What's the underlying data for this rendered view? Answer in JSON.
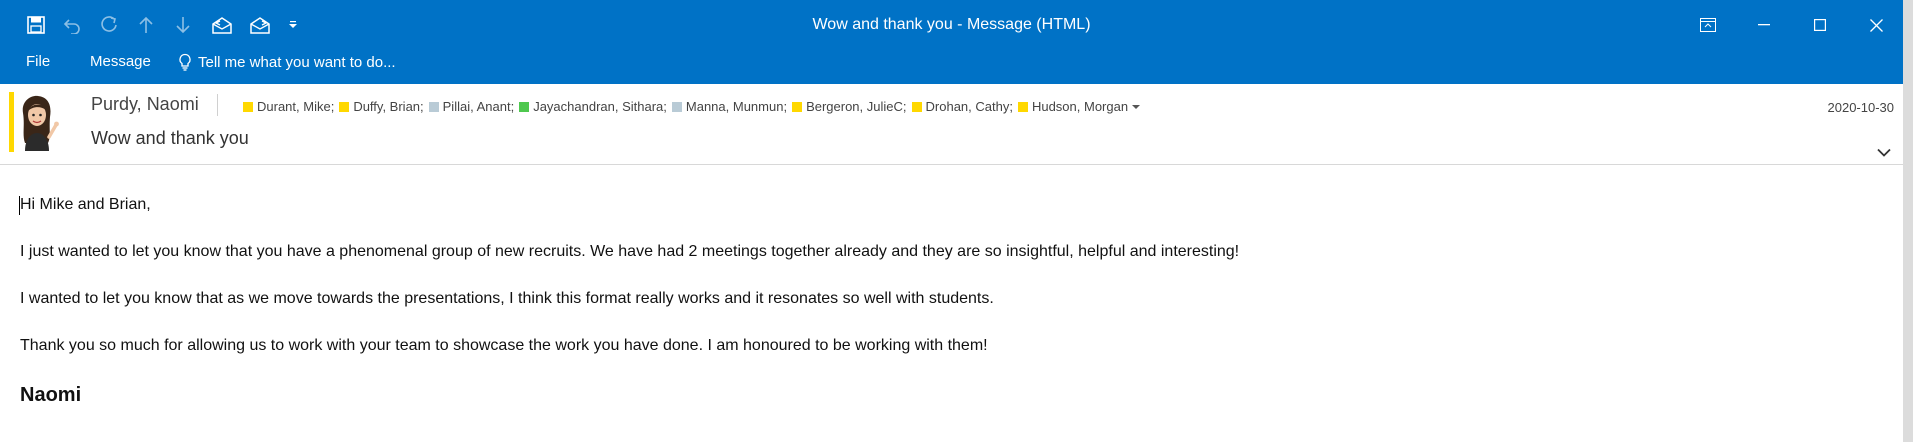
{
  "window": {
    "title": "Wow and thank you - Message (HTML)"
  },
  "qat": {
    "icons": [
      "save-icon",
      "undo-icon",
      "redo-icon",
      "previous-item-icon",
      "next-item-icon",
      "reply-icon",
      "forward-icon",
      "customize-qat-icon"
    ]
  },
  "window_controls": [
    "ribbon-display-options-icon",
    "minimize-icon",
    "maximize-icon",
    "close-icon"
  ],
  "ribbon": {
    "tabs": [
      {
        "label": "File"
      },
      {
        "label": "Message"
      }
    ],
    "tell_me": "Tell me what you want to do..."
  },
  "message": {
    "sender": "Purdy, Naomi",
    "recipients": [
      {
        "name": "Durant, Mike;",
        "color": "#ffd800"
      },
      {
        "name": "Duffy, Brian;",
        "color": "#ffd800"
      },
      {
        "name": "Pillai, Anant;",
        "color": "#b9cbd6"
      },
      {
        "name": "Jayachandran, Sithara;",
        "color": "#4fc84f"
      },
      {
        "name": "Manna, Munmun;",
        "color": "#b9cbd6"
      },
      {
        "name": "Bergeron, JulieC;",
        "color": "#ffd800"
      },
      {
        "name": "Drohan, Cathy;",
        "color": "#ffd800"
      },
      {
        "name": "Hudson, Morgan",
        "color": "#ffd800"
      }
    ],
    "subject": "Wow and thank you",
    "date": "2020-10-30",
    "body": {
      "greeting": "Hi Mike and Brian,",
      "p1": "I just wanted to let you know that you have a phenomenal group of new recruits. We have had 2 meetings together already and they are so insightful, helpful and interesting!",
      "p2": "I wanted to let you know that as we move towards the presentations, I think this format really works and it resonates so well with students.",
      "p3": "Thank you so much for allowing us to work with your team to showcase the work you have done. I am honoured to be working with them!",
      "signature": "Naomi"
    }
  },
  "colors": {
    "accent": "#0072c6",
    "sender_flag": "#ffd800"
  }
}
